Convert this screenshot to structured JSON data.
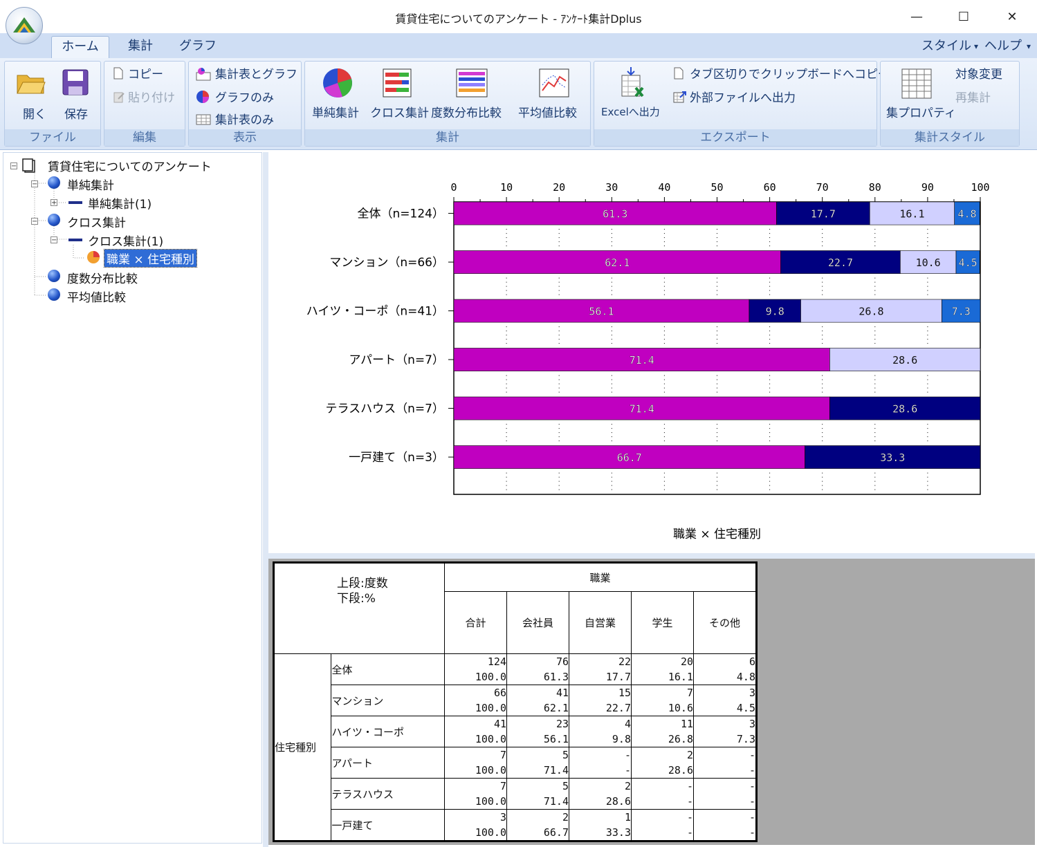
{
  "window": {
    "title": "賃貸住宅についてのアンケート - ｱﾝｹｰﾄ集計Dplus",
    "minimize": "—",
    "maximize": "☐",
    "close": "✕"
  },
  "ribbon": {
    "tabs": [
      "ホーム",
      "集計",
      "グラフ"
    ],
    "right_menu": [
      "スタイル",
      "ヘルプ"
    ],
    "groups": {
      "file": {
        "label": "ファイル",
        "open": "開く",
        "save": "保存"
      },
      "edit": {
        "label": "編集",
        "copy": "コピー",
        "paste": "貼り付け"
      },
      "view": {
        "label": "表示",
        "table_and_graph": "集計表とグラフ",
        "graph_only": "グラフのみ",
        "table_only": "集計表のみ"
      },
      "aggregate": {
        "label": "集計",
        "simple": "単純集計",
        "cross": "クロス集計",
        "freq": "度数分布比較",
        "mean": "平均値比較"
      },
      "export": {
        "label": "エクスポート",
        "excel": "Excelへ出力",
        "clipboard": "タブ区切りでクリップボードへコピー",
        "external": "外部ファイルへ出力"
      },
      "style": {
        "label": "集計スタイル",
        "properties": "集プロパティ",
        "change_target": "対象変更",
        "recalc": "再集計"
      }
    }
  },
  "tree": {
    "root": "賃貸住宅についてのアンケート",
    "simple": "単純集計",
    "simple_child": "単純集計(1)",
    "cross": "クロス集計",
    "cross_child": "クロス集計(1)",
    "cross_leaf": "職業 × 住宅種別",
    "freq": "度数分布比較",
    "mean": "平均値比較"
  },
  "colors": {
    "kaishain": "#c000c0",
    "jieigyo": "#000080",
    "gakusei": "#d0d0ff",
    "sonota": "#1a6ad6"
  },
  "chart_data": {
    "type": "bar",
    "orientation": "horizontal-stacked",
    "title": "職業 × 住宅種別",
    "xlim": [
      0,
      100
    ],
    "ticks": [
      0,
      10,
      20,
      30,
      40,
      50,
      60,
      70,
      80,
      90,
      100
    ],
    "categories": [
      "全体（n=124）",
      "マンション（n=66）",
      "ハイツ・コーポ（n=41）",
      "アパート（n=7）",
      "テラスハウス（n=7）",
      "一戸建て（n=3）"
    ],
    "series": [
      {
        "name": "会社員",
        "values": [
          61.3,
          62.1,
          56.1,
          71.4,
          71.4,
          66.7
        ]
      },
      {
        "name": "自営業",
        "values": [
          17.7,
          22.7,
          9.8,
          0,
          28.6,
          33.3
        ]
      },
      {
        "name": "学生",
        "values": [
          16.1,
          10.6,
          26.8,
          28.6,
          0,
          0
        ]
      },
      {
        "name": "その他",
        "values": [
          4.8,
          4.5,
          7.3,
          0,
          0,
          0
        ]
      }
    ]
  },
  "table": {
    "corner_top": "上段:度数",
    "corner_bottom": "下段:%",
    "col_group": "職業",
    "row_group": "住宅種別",
    "columns": [
      "合計",
      "会社員",
      "自営業",
      "学生",
      "その他"
    ],
    "rows": [
      {
        "label": "全体",
        "counts": [
          "124",
          "76",
          "22",
          "20",
          "6"
        ],
        "pcts": [
          "100.0",
          "61.3",
          "17.7",
          "16.1",
          "4.8"
        ]
      },
      {
        "label": "マンション",
        "counts": [
          "66",
          "41",
          "15",
          "7",
          "3"
        ],
        "pcts": [
          "100.0",
          "62.1",
          "22.7",
          "10.6",
          "4.5"
        ]
      },
      {
        "label": "ハイツ・コーポ",
        "counts": [
          "41",
          "23",
          "4",
          "11",
          "3"
        ],
        "pcts": [
          "100.0",
          "56.1",
          "9.8",
          "26.8",
          "7.3"
        ]
      },
      {
        "label": "アパート",
        "counts": [
          "7",
          "5",
          "-",
          "2",
          "-"
        ],
        "pcts": [
          "100.0",
          "71.4",
          "-",
          "28.6",
          "-"
        ]
      },
      {
        "label": "テラスハウス",
        "counts": [
          "7",
          "5",
          "2",
          "-",
          "-"
        ],
        "pcts": [
          "100.0",
          "71.4",
          "28.6",
          "-",
          "-"
        ]
      },
      {
        "label": "一戸建て",
        "counts": [
          "3",
          "2",
          "1",
          "-",
          "-"
        ],
        "pcts": [
          "100.0",
          "66.7",
          "33.3",
          "-",
          "-"
        ]
      }
    ]
  }
}
